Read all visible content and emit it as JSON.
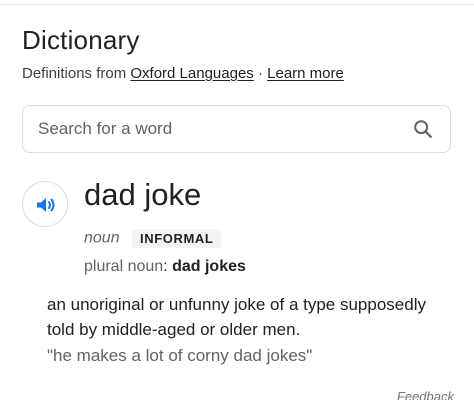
{
  "header": {
    "title": "Dictionary",
    "source_prefix": "Definitions from",
    "source_link": "Oxford Languages",
    "separator": "·",
    "learn_more": "Learn more"
  },
  "search": {
    "placeholder": "Search for a word",
    "value": ""
  },
  "entry": {
    "word": "dad joke",
    "part_of_speech": "noun",
    "register_label": "INFORMAL",
    "plural_label": "plural noun",
    "plural_colon": ":",
    "plural_form": "dad jokes",
    "definition": "an unoriginal or unfunny joke of a type supposedly told by middle-aged or older men.",
    "example": "\"he makes a lot of corny dad jokes\""
  },
  "footer": {
    "feedback": "Feedback"
  },
  "icons": {
    "speaker": "speaker-icon",
    "search": "search-icon"
  },
  "colors": {
    "accent_blue": "#1a73e8",
    "secondary_text": "#5f6368",
    "border": "#dadce0",
    "badge_bg": "#f1f3f4"
  }
}
